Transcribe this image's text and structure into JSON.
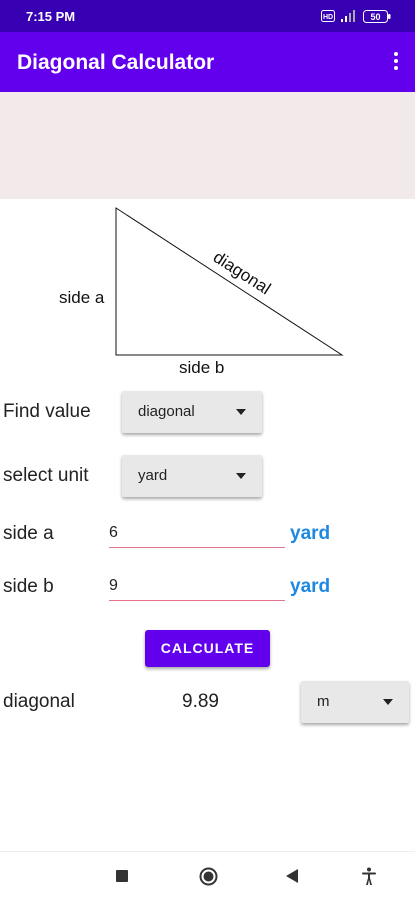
{
  "status_bar": {
    "time": "7:15 PM",
    "battery": "50",
    "icons": [
      "hd-icon",
      "signal-icon",
      "battery-icon"
    ]
  },
  "app_bar": {
    "title": "Diagonal Calculator",
    "menu_icon": "more-vert-icon"
  },
  "diagram": {
    "side_a_label": "side a",
    "side_b_label": "side b",
    "diagonal_label": "diagonal"
  },
  "form": {
    "find_value": {
      "label": "Find value",
      "selected": "diagonal"
    },
    "select_unit": {
      "label": "select unit",
      "selected": "yard"
    },
    "side_a": {
      "label": "side a",
      "value": "6",
      "unit": "yard"
    },
    "side_b": {
      "label": "side b",
      "value": "9",
      "unit": "yard"
    }
  },
  "calculate_button": {
    "label": "CALCULATE"
  },
  "result": {
    "label": "diagonal",
    "value": "9.89",
    "unit": "m"
  },
  "nav_bar": {
    "icons": [
      "recents-square-icon",
      "home-circle-icon",
      "back-triangle-icon",
      "accessibility-icon"
    ]
  },
  "colors": {
    "status_bar": "#3700b3",
    "app_bar": "#6200ee",
    "accent": "#1e88e5",
    "input_underline": "#e57390",
    "ad_background": "#f2e9ea"
  }
}
